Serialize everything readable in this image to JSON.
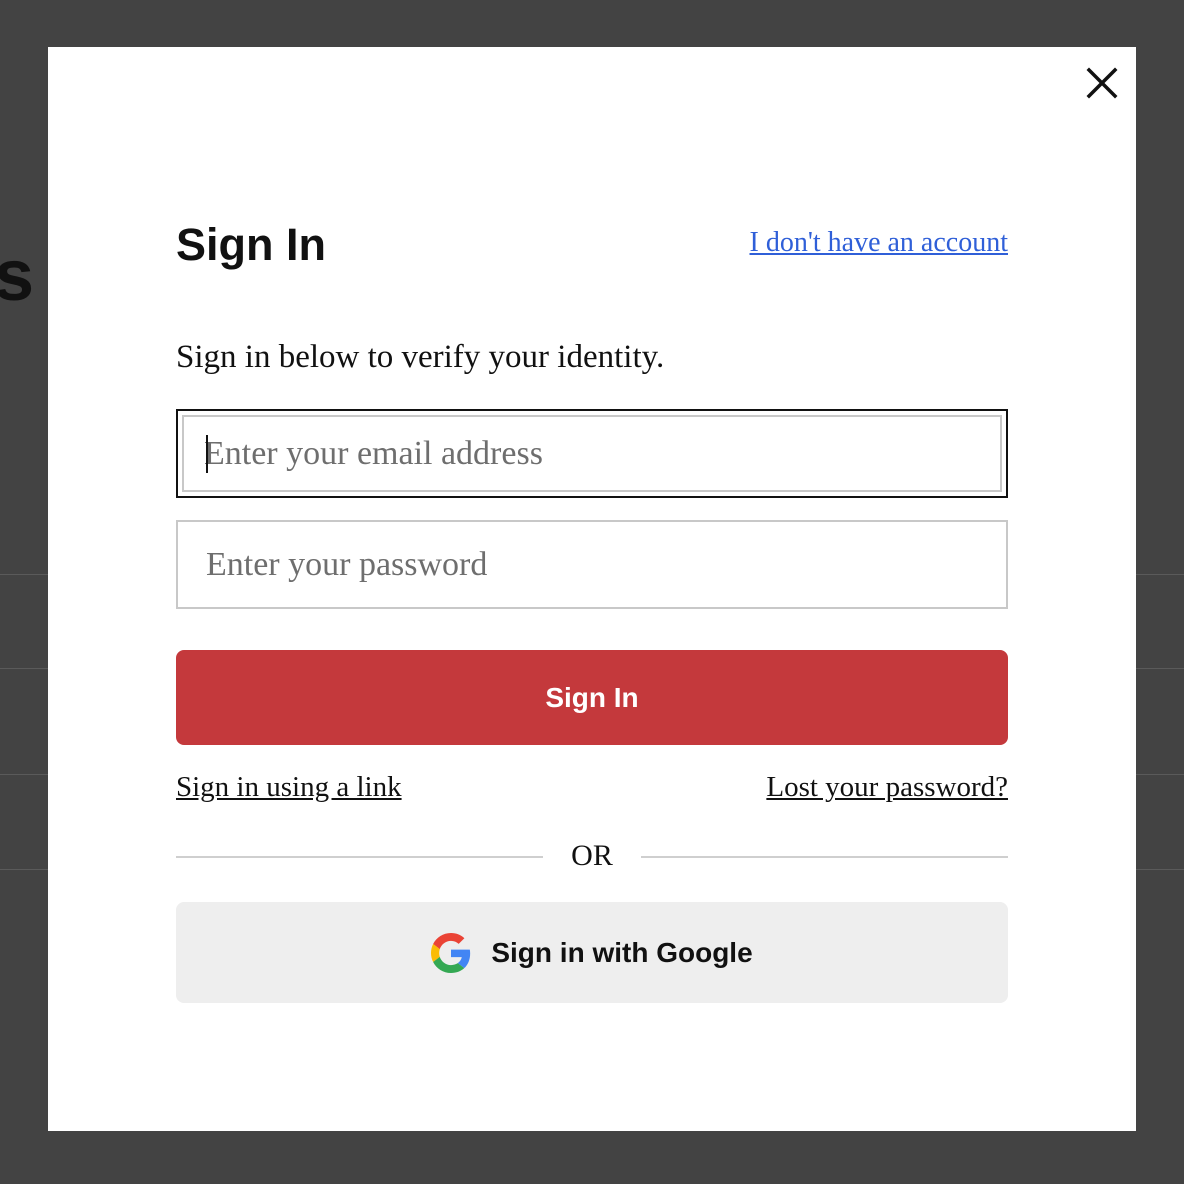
{
  "background": {
    "partial_letter": "s"
  },
  "modal": {
    "close_icon": "close-icon",
    "title": "Sign In",
    "register_link": "I don't have an account",
    "subtitle": "Sign in below to verify your identity.",
    "email": {
      "value": "",
      "placeholder": "Enter your email address"
    },
    "password": {
      "value": "",
      "placeholder": "Enter your password"
    },
    "signin_button": "Sign In",
    "signin_link": "Sign in using a link",
    "lost_password": "Lost your password?",
    "divider_text": "OR",
    "google_button": {
      "label": "Sign in with Google",
      "icon": "google-icon"
    }
  },
  "colors": {
    "overlay": "#434343",
    "primary_button": "#c4393c",
    "link": "#2f5fd8",
    "secondary_button": "#eeeeee"
  }
}
